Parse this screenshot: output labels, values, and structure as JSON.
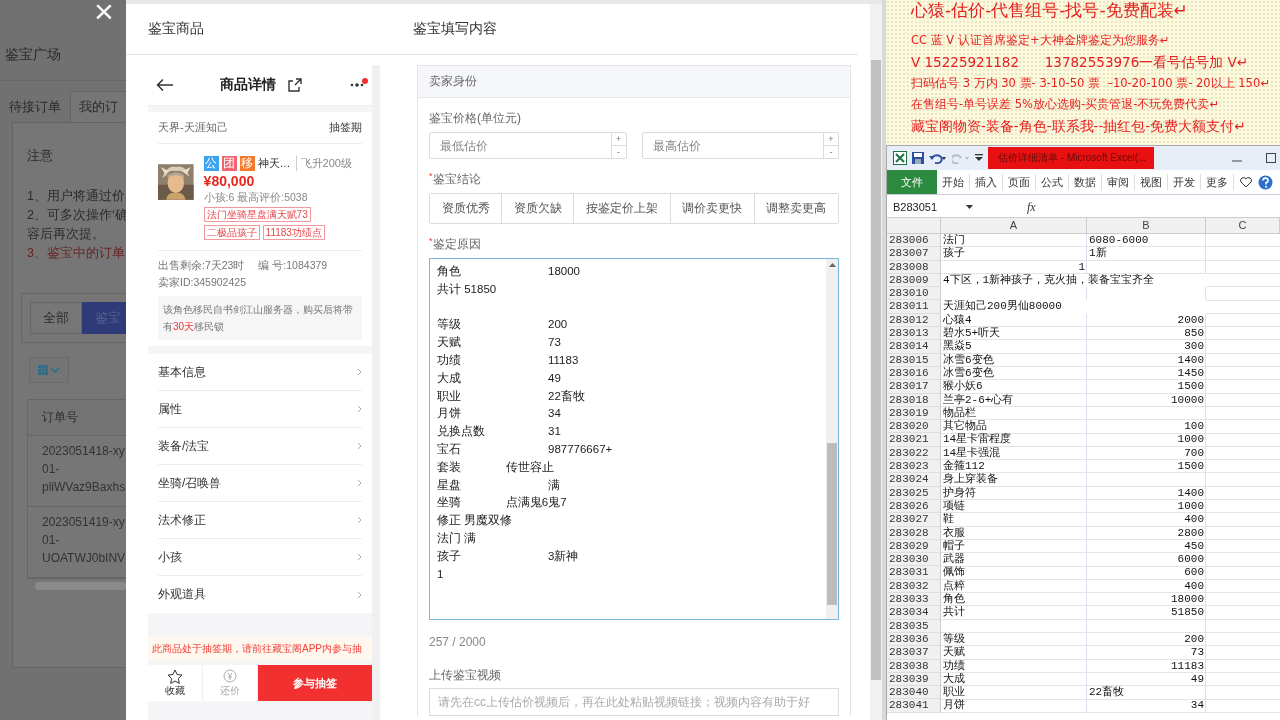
{
  "background_page": {
    "close": "×",
    "title": "鉴宝广场",
    "tabs": [
      {
        "label": "待接订单",
        "selected": false
      },
      {
        "label": "我的订",
        "selected": true
      }
    ],
    "notice_title": "注意",
    "notes": [
      {
        "text": "1、用户将通过价",
        "kind": "normal"
      },
      {
        "text": "2、可多次操作‘确",
        "kind": "normal"
      },
      {
        "text": "容后再次提。",
        "kind": "normal"
      },
      {
        "text": "3、鉴宝中的订单",
        "kind": "warning"
      }
    ],
    "filters": [
      {
        "label": "全部",
        "selected": false
      },
      {
        "label": "鉴宝",
        "selected": true
      }
    ],
    "table": {
      "columns": [
        "订单号"
      ],
      "rows": [
        {
          "lines": [
            "2023051418-xy",
            "01-",
            "pliWVaz9Baxhs"
          ]
        },
        {
          "lines": [
            "2023051419-xy",
            "01-",
            "UOATWJ0bINV"
          ]
        }
      ]
    }
  },
  "modal": {
    "left_title": "鉴宝商品",
    "right_title": "鉴宝填写内容"
  },
  "product": {
    "header_title": "商品详情",
    "notification": true,
    "server": "天界-天涯知己",
    "phase": "抽签期",
    "badges": [
      {
        "text": "公",
        "color": "#3aa4f0"
      },
      {
        "text": "团",
        "color": "#f0646e"
      },
      {
        "text": "移",
        "color": "#f57a2b"
      }
    ],
    "name": "神天…",
    "level": "飞升200级",
    "price": "¥80,000",
    "stats": "小孩:6 最高评价:5038",
    "tags": [
      "法门坐骑星盘满天赋73",
      "二极品孩子",
      "11183功绩点"
    ],
    "remaining": "出售剩余:7天23时",
    "serial": "编 号:1084379",
    "seller": "卖家ID:345902425",
    "migration_note": "该角色移民自书剑江山服务器，购买后将带有**30天**移民锁",
    "menu": [
      "基本信息",
      "属性",
      "装备/法宝",
      "坐骑/召唤兽",
      "法术修正",
      "小孩",
      "外观道具"
    ],
    "lottery_notice": "此商品处于抽签期，请前往藏宝阁APP内参与抽",
    "actions": [
      {
        "label": "收藏",
        "kind": "favorite"
      },
      {
        "label": "还价",
        "kind": "bargain"
      },
      {
        "label": "参与抽签",
        "kind": "primary"
      }
    ]
  },
  "form": {
    "section": "卖家身份",
    "price_label": "鉴宝价格(单位元)",
    "price_fields": [
      {
        "placeholder": "最低估价",
        "up": "+",
        "down": "-"
      },
      {
        "placeholder": "最高估价",
        "up": "+",
        "down": "-"
      }
    ],
    "conclusion": {
      "mark": "*",
      "label": "鉴宝结论",
      "options": [
        {
          "label": "资质优秀",
          "selected": false
        },
        {
          "label": "资质欠缺",
          "selected": false
        },
        {
          "label": "按鉴定价上架",
          "selected": false
        },
        {
          "label": "调价卖更快",
          "selected": false
        },
        {
          "label": "调整卖更高",
          "selected": false
        }
      ]
    },
    "reason": {
      "mark": "*",
      "label": "鉴定原因",
      "paragraphs": [
        [
          "角色\t18000",
          "共计 51850"
        ],
        [
          "等级\t200",
          "天赋\t73",
          "功绩\t11183",
          "大成\t49",
          "职业\t22畜牧",
          "月饼\t34",
          "兑换点数\t31",
          "宝石\t987776667+",
          "套装              传世容止",
          "星盘\t满",
          "坐骑              点满鬼6鬼7",
          "修正 男魔双修",
          "法门 满",
          "孩子\t3新神",
          "1"
        ]
      ],
      "count": "257 / 2000"
    },
    "video": {
      "label": "上传鉴宝视频",
      "placeholder": "请先在cc上传估价视频后，再在此处粘贴视频链接；视频内容有助于好"
    }
  },
  "document": {
    "lines": [
      {
        "text": "心猿-估价-代售组号-找号-免费配装↵",
        "kind": "heading"
      },
      {
        "text": "CC 蓝 V 认证首席鉴定+大神金牌鉴定为您服务↵",
        "kind": "normal"
      },
      {
        "text": "V 15225921182      13782553976一看号估号加 V↵",
        "kind": "large"
      },
      {
        "text": "扫码估号 3 万内 30 票- 3-10-50 票  –10-20-100 票- 20以上 150↵",
        "kind": "normal"
      },
      {
        "text": "在售组号-单号误差 5%放心选购-买贵管退-不玩免费代卖↵",
        "kind": "normal"
      },
      {
        "text": "藏宝阁物资-装备-角色-联系我--抽红包-免费大额支付↵",
        "kind": "large"
      }
    ]
  },
  "excel": {
    "title": "估价详细清单 - Microsoft Excel(...",
    "ribbon": [
      {
        "label": "文件",
        "kind": "file"
      },
      {
        "label": "开始",
        "kind": "tab"
      },
      {
        "label": "插入",
        "kind": "tab"
      },
      {
        "label": "页面",
        "kind": "tab"
      },
      {
        "label": "公式",
        "kind": "tab"
      },
      {
        "label": "数据",
        "kind": "tab"
      },
      {
        "label": "审阅",
        "kind": "tab"
      },
      {
        "label": "视图",
        "kind": "tab"
      },
      {
        "label": "开发",
        "kind": "tab"
      },
      {
        "label": "更多",
        "kind": "tab"
      }
    ],
    "name_box": "B283051",
    "function_label": "fx",
    "columns": [
      "A",
      "B",
      "C"
    ],
    "rows": [
      {
        "row": "283006",
        "a": {
          "text": "法门",
          "kind": "text"
        },
        "b": {
          "text": "6080-6000",
          "kind": "text"
        }
      },
      {
        "row": "283007",
        "a": {
          "text": "孩子",
          "kind": "text"
        },
        "b": {
          "text": "1新",
          "kind": "text"
        }
      },
      {
        "row": "283008",
        "a": {
          "text": "1",
          "kind": "number"
        }
      },
      {
        "row": "283009",
        "a": {
          "text": "4下区，1新神孩子，克火抽，装备宝宝齐全",
          "kind": "text"
        }
      },
      {
        "row": "283010"
      },
      {
        "row": "283011",
        "a": {
          "text": "天涯知己200男仙80000",
          "kind": "text"
        }
      },
      {
        "row": "283012",
        "a": {
          "text": "心猿4",
          "kind": "text"
        },
        "b": {
          "text": "2000",
          "kind": "number"
        }
      },
      {
        "row": "283013",
        "a": {
          "text": "碧水5+听天",
          "kind": "text"
        },
        "b": {
          "text": "850",
          "kind": "number"
        }
      },
      {
        "row": "283014",
        "a": {
          "text": "黑焱5",
          "kind": "text"
        },
        "b": {
          "text": "300",
          "kind": "number"
        }
      },
      {
        "row": "283015",
        "a": {
          "text": "冰雪6变色",
          "kind": "text"
        },
        "b": {
          "text": "1400",
          "kind": "number"
        }
      },
      {
        "row": "283016",
        "a": {
          "text": "冰雪6变色",
          "kind": "text"
        },
        "b": {
          "text": "1450",
          "kind": "number"
        }
      },
      {
        "row": "283017",
        "a": {
          "text": "猴小妖6",
          "kind": "text"
        },
        "b": {
          "text": "1500",
          "kind": "number"
        }
      },
      {
        "row": "283018",
        "a": {
          "text": "兰亭2-6+心有",
          "kind": "text"
        },
        "b": {
          "text": "10000",
          "kind": "number"
        }
      },
      {
        "row": "283019",
        "a": {
          "text": "物品栏",
          "kind": "text"
        }
      },
      {
        "row": "283020",
        "a": {
          "text": "其它物品",
          "kind": "text"
        },
        "b": {
          "text": "100",
          "kind": "number"
        }
      },
      {
        "row": "283021",
        "a": {
          "text": "14星卡雷程度",
          "kind": "text"
        },
        "b": {
          "text": "1000",
          "kind": "number"
        }
      },
      {
        "row": "283022",
        "a": {
          "text": "14星卡强混",
          "kind": "text"
        },
        "b": {
          "text": "700",
          "kind": "number"
        }
      },
      {
        "row": "283023",
        "a": {
          "text": "金箍112",
          "kind": "text"
        },
        "b": {
          "text": "1500",
          "kind": "number"
        }
      },
      {
        "row": "283024",
        "a": {
          "text": "身上穿装备",
          "kind": "text"
        }
      },
      {
        "row": "283025",
        "a": {
          "text": "护身符",
          "kind": "text"
        },
        "b": {
          "text": "1400",
          "kind": "number"
        }
      },
      {
        "row": "283026",
        "a": {
          "text": "项链",
          "kind": "text"
        },
        "b": {
          "text": "1000",
          "kind": "number"
        }
      },
      {
        "row": "283027",
        "a": {
          "text": "鞋",
          "kind": "text"
        },
        "b": {
          "text": "400",
          "kind": "number"
        }
      },
      {
        "row": "283028",
        "a": {
          "text": "衣服",
          "kind": "text"
        },
        "b": {
          "text": "2800",
          "kind": "number"
        }
      },
      {
        "row": "283029",
        "a": {
          "text": "帽子",
          "kind": "text"
        },
        "b": {
          "text": "450",
          "kind": "number"
        }
      },
      {
        "row": "283030",
        "a": {
          "text": "武器",
          "kind": "text"
        },
        "b": {
          "text": "6000",
          "kind": "number"
        }
      },
      {
        "row": "283031",
        "a": {
          "text": "佩饰",
          "kind": "text"
        },
        "b": {
          "text": "600",
          "kind": "number"
        }
      },
      {
        "row": "283032",
        "a": {
          "text": "点粹",
          "kind": "text"
        },
        "b": {
          "text": "400",
          "kind": "number"
        }
      },
      {
        "row": "283033",
        "a": {
          "text": "角色",
          "kind": "text"
        },
        "b": {
          "text": "18000",
          "kind": "number"
        }
      },
      {
        "row": "283034",
        "a": {
          "text": "共计",
          "kind": "text"
        },
        "b": {
          "text": "51850",
          "kind": "number"
        }
      },
      {
        "row": "283035"
      },
      {
        "row": "283036",
        "a": {
          "text": "等级",
          "kind": "text"
        },
        "b": {
          "text": "200",
          "kind": "number"
        }
      },
      {
        "row": "283037",
        "a": {
          "text": "天赋",
          "kind": "text"
        },
        "b": {
          "text": "73",
          "kind": "number"
        }
      },
      {
        "row": "283038",
        "a": {
          "text": "功绩",
          "kind": "text"
        },
        "b": {
          "text": "11183",
          "kind": "number"
        }
      },
      {
        "row": "283039",
        "a": {
          "text": "大成",
          "kind": "text"
        },
        "b": {
          "text": "49",
          "kind": "number"
        }
      },
      {
        "row": "283040",
        "a": {
          "text": "职业",
          "kind": "text"
        },
        "b": {
          "text": "22畜牧",
          "kind": "text"
        }
      },
      {
        "row": "283041",
        "a": {
          "text": "月饼",
          "kind": "text"
        },
        "b": {
          "text": "34",
          "kind": "number"
        }
      }
    ]
  }
}
